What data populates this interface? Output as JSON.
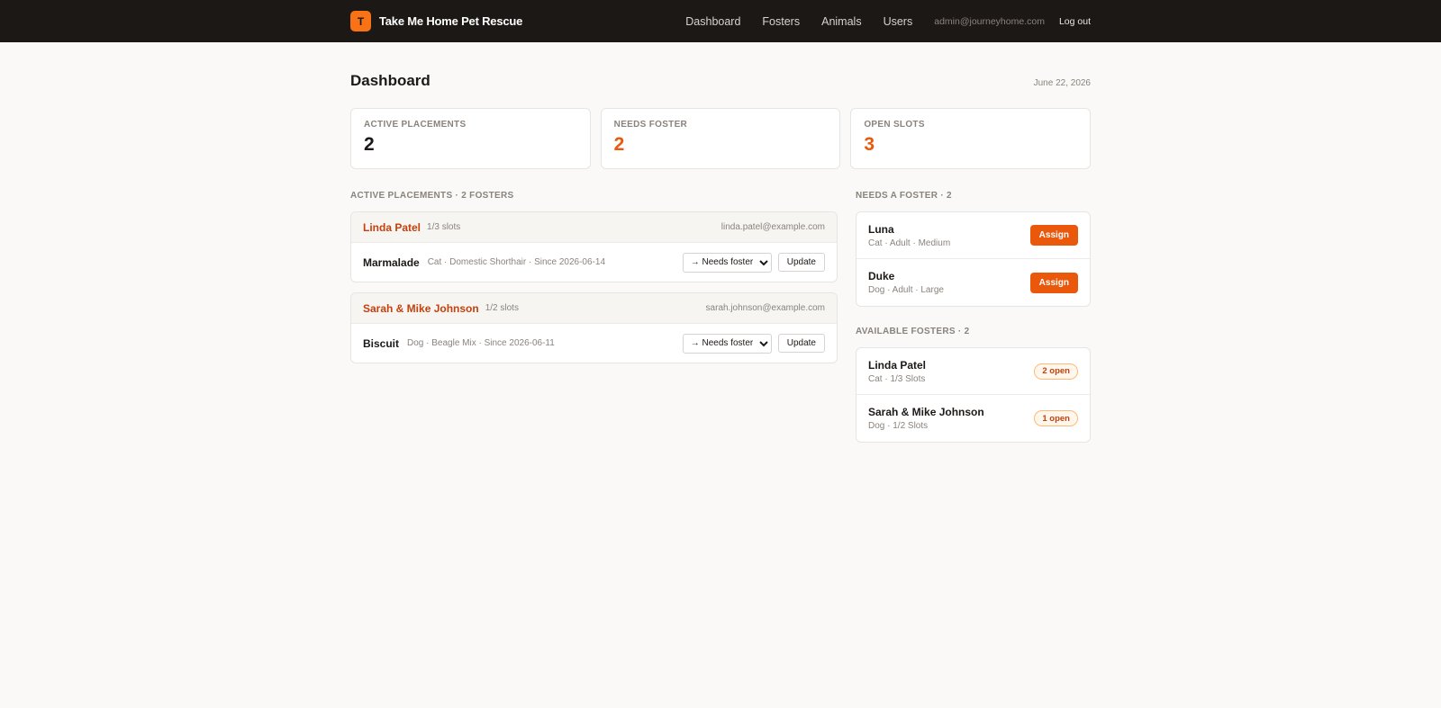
{
  "app": {
    "logo_letter": "T",
    "name": "Take Me Home Pet Rescue"
  },
  "nav": {
    "links": [
      "Dashboard",
      "Fosters",
      "Animals",
      "Users"
    ],
    "user_email": "admin@journeyhome.com",
    "logout_label": "Log out"
  },
  "page": {
    "title": "Dashboard",
    "date": "June 22, 2026"
  },
  "stats": [
    {
      "label": "ACTIVE PLACEMENTS",
      "value": "2"
    },
    {
      "label": "NEEDS FOSTER",
      "value": "2"
    },
    {
      "label": "OPEN SLOTS",
      "value": "3"
    }
  ],
  "active_placements": {
    "section_label": "ACTIVE PLACEMENTS · 2 FOSTERS",
    "select_value": "→ Needs foster",
    "update_label": "Update",
    "fosters": [
      {
        "name": "Linda Patel",
        "slots": "1/3 slots",
        "email": "linda.patel@example.com",
        "animal": {
          "name": "Marmalade",
          "meta": "Cat · Domestic Shorthair · Since 2026-06-14"
        }
      },
      {
        "name": "Sarah & Mike Johnson",
        "slots": "1/2 slots",
        "email": "sarah.johnson@example.com",
        "animal": {
          "name": "Biscuit",
          "meta": "Dog · Beagle Mix · Since 2026-06-11"
        }
      }
    ]
  },
  "needs_foster": {
    "section_label": "NEEDS A FOSTER · 2",
    "assign_label": "Assign",
    "animals": [
      {
        "name": "Luna",
        "meta": "Cat · Adult · Medium"
      },
      {
        "name": "Duke",
        "meta": "Dog · Adult · Large"
      }
    ]
  },
  "available_fosters": {
    "section_label": "AVAILABLE FOSTERS · 2",
    "fosters": [
      {
        "name": "Linda Patel",
        "meta": "Cat · 1/3 Slots",
        "badge": "2 open"
      },
      {
        "name": "Sarah & Mike Johnson",
        "meta": "Dog · 1/2 Slots",
        "badge": "1 open"
      }
    ]
  },
  "colors": {
    "accent": "#ea580c",
    "topbar": "#1c1815",
    "foster_name": "#c2410c"
  }
}
